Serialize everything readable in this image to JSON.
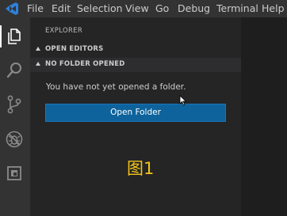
{
  "menubar": {
    "logo_icon": "vscode-logo-icon",
    "items": [
      "File",
      "Edit",
      "Selection",
      "View",
      "Go",
      "Debug",
      "Terminal",
      "Help"
    ]
  },
  "activitybar": {
    "icons": [
      "files-icon",
      "search-icon",
      "source-control-icon",
      "debug-icon",
      "extensions-icon"
    ]
  },
  "sidebar": {
    "title": "EXPLORER",
    "sections": [
      {
        "label": "OPEN EDITORS"
      },
      {
        "label": "NO FOLDER OPENED"
      }
    ],
    "message": "You have not yet opened a folder.",
    "open_folder_button": "Open Folder"
  },
  "caption": "图1",
  "colors": {
    "menubar_bg": "#333333",
    "sidebar_bg": "#252526",
    "editor_bg": "#1e1e1e",
    "button_bg": "#0e639c",
    "caption_color": "#f3c41a",
    "logo_blue": "#2f80d9"
  }
}
